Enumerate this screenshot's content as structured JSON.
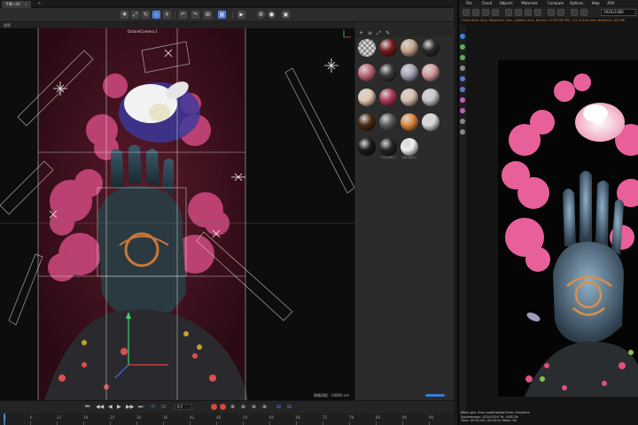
{
  "c4d": {
    "tab_title": "手掌.c4d",
    "tab_close": "×",
    "tab_add": "+",
    "viewport_label": "透视",
    "camera_label": "OctaneCamera.1",
    "viewport_status": "网格间距 : 10000 cm",
    "toolbar_icons": [
      "move-icon",
      "scale-icon",
      "rotate-icon",
      "live-select-icon",
      "axis-icon",
      "undo-icon",
      "redo-icon",
      "render-view-icon",
      "render-settings-icon",
      "camera-icon",
      "light-icon"
    ]
  },
  "materials": {
    "toolbar": [
      "+",
      "≡",
      "⤢",
      "✎"
    ],
    "items": [
      {
        "label": "",
        "color": "#c8c8c8",
        "type": "checker"
      },
      {
        "label": "",
        "color": "#7a1c1c"
      },
      {
        "label": "",
        "color": "#caa48a"
      },
      {
        "label": "",
        "color": "#2b2b2b"
      },
      {
        "label": "",
        "color": "#c06a7a"
      },
      {
        "label": "",
        "color": "#3a3a3a"
      },
      {
        "label": "",
        "color": "#a8a3b8"
      },
      {
        "label": "",
        "color": "#d79a9a"
      },
      {
        "label": "",
        "color": "#e6c8b2"
      },
      {
        "label": "",
        "color": "#b23b5a"
      },
      {
        "label": "",
        "color": "#d9bfb0"
      },
      {
        "label": "",
        "color": "#c7c7c7"
      },
      {
        "label": "",
        "color": "#4a2a14"
      },
      {
        "label": "",
        "color": "#5a5a5a"
      },
      {
        "label": "",
        "color": "#e08a3a"
      },
      {
        "label": "",
        "color": "#d8d8d8"
      },
      {
        "label": "",
        "color": "#1a1a1a"
      },
      {
        "label": "Oct.Diff.1",
        "color": "#262626"
      },
      {
        "label": "Oct.Diff.1",
        "color": "#f0f0f0"
      }
    ]
  },
  "timeline": {
    "current_frame": "0 F",
    "ticks": [
      "0",
      "6",
      "12",
      "18",
      "24",
      "30",
      "36",
      "42",
      "48",
      "54",
      "60",
      "66",
      "72",
      "78",
      "84",
      "90",
      "96"
    ]
  },
  "render_window": {
    "menu": [
      "File",
      "Cloud",
      "Objects",
      "Materials",
      "Compare",
      "Options",
      "Help",
      "AOV"
    ],
    "resolution": "1920x1080",
    "status": "Check time: 0ms, MeshGen: 0ms, Update: 0ms, Render: 07:09:08 GPU: 1/1  Out-of-core used/max: 0/0 Mb",
    "stats": [
      "Mesh gen: 0ms  Load/Update time: 0ms/0ms",
      "Spp/maxspp: 1024/1024   Tri: 0/4523k",
      "Time: 00:01:58 / 00:02:01   Mesh: 56"
    ]
  },
  "colors": {
    "accent": "#3d7ce0",
    "record": "#d24a3c",
    "warning_text": "#d9823b"
  }
}
